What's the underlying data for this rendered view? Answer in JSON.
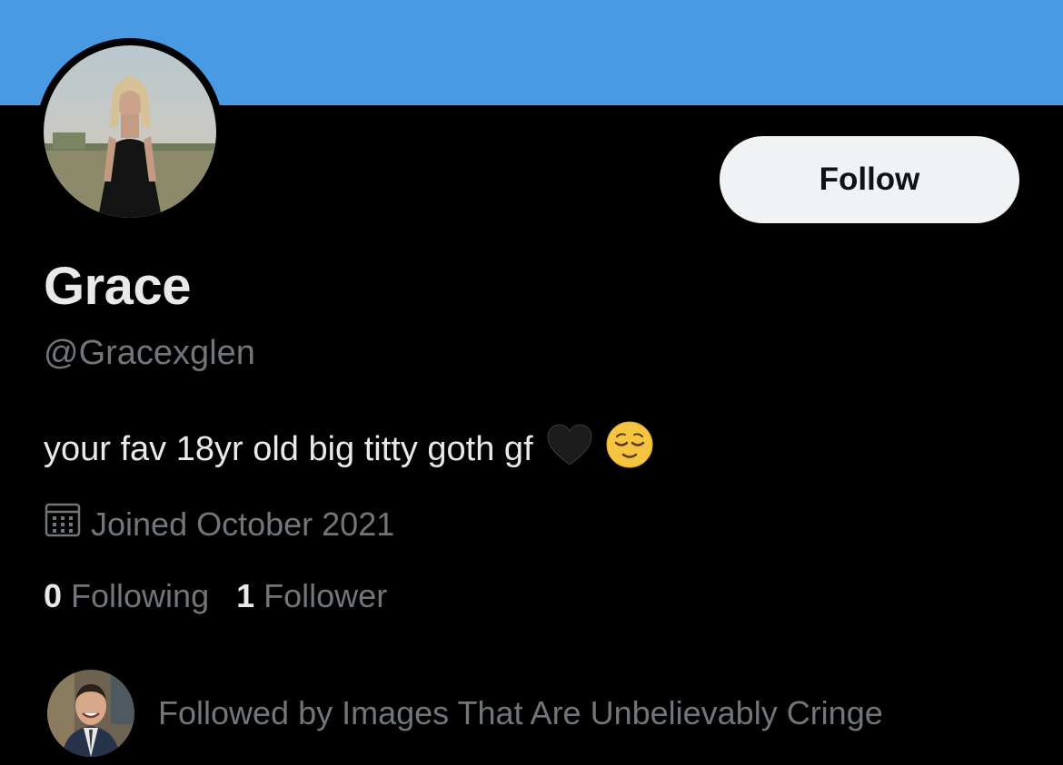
{
  "colors": {
    "banner": "#4a9ae3",
    "follow_button_bg": "#eff3f4",
    "follow_button_text": "#0f1419",
    "primary_text": "#e7e9ea",
    "secondary_text": "#71767b",
    "background": "#000000"
  },
  "profile": {
    "avatar_icon": "profile-photo",
    "display_name": "Grace",
    "handle": "@Gracexglen",
    "bio": "your fav 18yr old big titty goth gf",
    "bio_emojis": [
      "black-heart",
      "relieved-face"
    ],
    "joined": "Joined October 2021"
  },
  "actions": {
    "follow_label": "Follow"
  },
  "stats": {
    "following_count": "0",
    "following_label": "Following",
    "followers_count": "1",
    "followers_label": "Follower"
  },
  "followed_by": {
    "avatar_icon": "follower-avatar",
    "text": "Followed by Images That Are Unbelievably Cringe"
  }
}
